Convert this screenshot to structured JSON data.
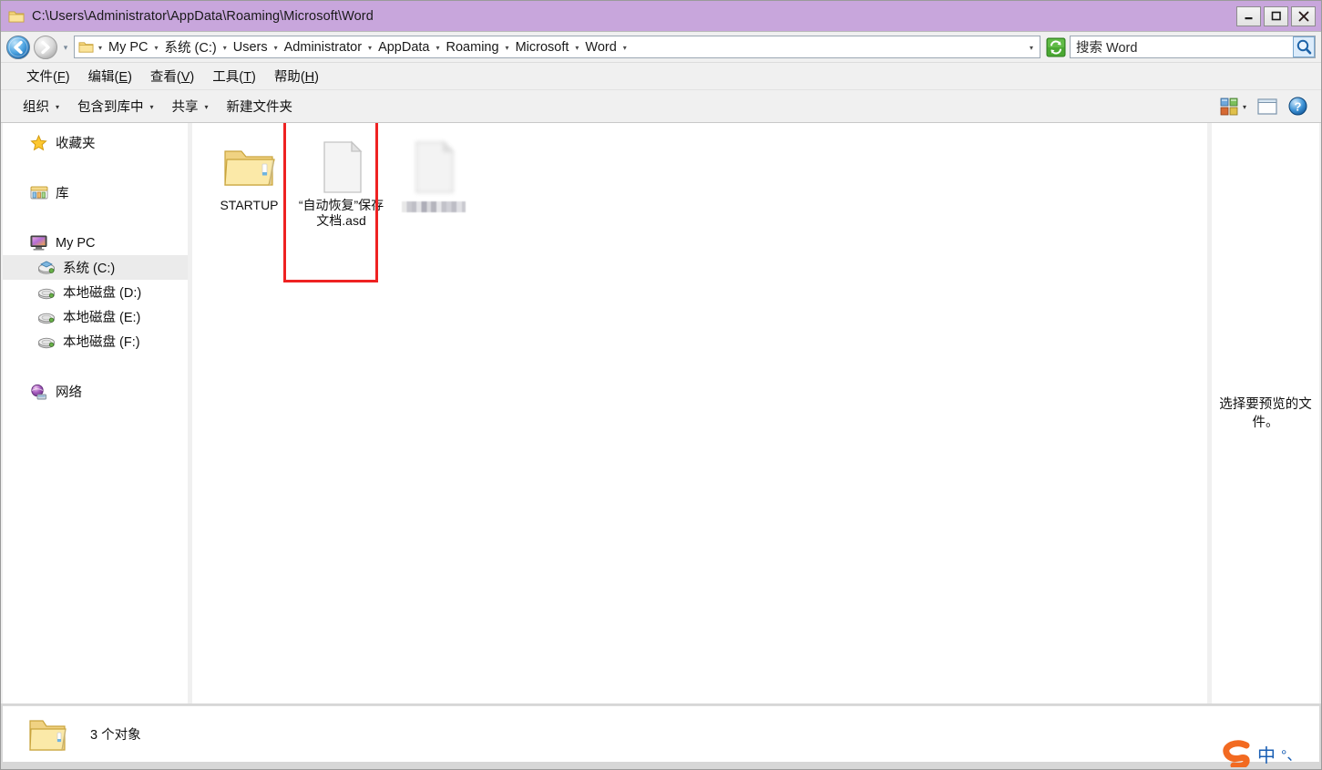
{
  "window": {
    "title": "C:\\Users\\Administrator\\AppData\\Roaming\\Microsoft\\Word",
    "title_icon": "folder-icon",
    "titlebar_color": "#c8a6dc",
    "controls": {
      "minimize_label": "_",
      "maximize_label": "□",
      "close_label": "✕"
    }
  },
  "address": {
    "back_icon": "back-arrow-icon",
    "forward_icon": "forward-arrow-icon",
    "history_caret": "▾",
    "folder_icon": "folder-icon",
    "crumbs": [
      {
        "label": "My PC"
      },
      {
        "label": "系统 (C:)"
      },
      {
        "label": "Users"
      },
      {
        "label": "Administrator"
      },
      {
        "label": "AppData"
      },
      {
        "label": "Roaming"
      },
      {
        "label": "Microsoft"
      },
      {
        "label": "Word"
      }
    ],
    "separator": "▾",
    "dropdown_caret": "▾",
    "refresh_icon": "refresh-icon",
    "search_placeholder": "搜索 Word",
    "search_icon": "magnifier-icon"
  },
  "menu": {
    "items": [
      {
        "text": "文件",
        "accel": "F"
      },
      {
        "text": "编辑",
        "accel": "E"
      },
      {
        "text": "查看",
        "accel": "V"
      },
      {
        "text": "工具",
        "accel": "T"
      },
      {
        "text": "帮助",
        "accel": "H"
      }
    ]
  },
  "toolbar": {
    "organize_label": "组织",
    "include_library_label": "包含到库中",
    "share_label": "共享",
    "new_folder_label": "新建文件夹",
    "caret": "▾",
    "view_icon": "view-options-icon",
    "view_caret": "▾",
    "preview_pane_icon": "preview-pane-icon",
    "help_icon": "help-icon"
  },
  "sidebar": {
    "items": [
      {
        "label": "收藏夹",
        "icon": "star-icon",
        "level": 0,
        "selected": false
      },
      {
        "label": "库",
        "icon": "library-icon",
        "level": 0,
        "selected": false
      },
      {
        "label": "My PC",
        "icon": "monitor-icon",
        "level": 0,
        "selected": false
      },
      {
        "label": "系统 (C:)",
        "icon": "system-drive-icon",
        "level": 1,
        "selected": true
      },
      {
        "label": "本地磁盘 (D:)",
        "icon": "drive-icon",
        "level": 1,
        "selected": false
      },
      {
        "label": "本地磁盘 (E:)",
        "icon": "drive-icon",
        "level": 1,
        "selected": false
      },
      {
        "label": "本地磁盘 (F:)",
        "icon": "drive-icon",
        "level": 1,
        "selected": false
      },
      {
        "label": "网络",
        "icon": "network-icon",
        "level": 0,
        "selected": false
      }
    ]
  },
  "files": [
    {
      "name": "STARTUP",
      "icon": "folder-icon",
      "redacted": false,
      "annotated": false
    },
    {
      "name": "“自动恢复”保存文档.asd",
      "icon": "document-icon",
      "redacted": false,
      "annotated": true
    },
    {
      "name": "",
      "icon": "document-icon",
      "redacted": true,
      "annotated": false
    }
  ],
  "annotation": {
    "color": "#ee2222",
    "target": "“自动恢复”保存文档.asd"
  },
  "preview": {
    "empty_text": "选择要预览的文件。"
  },
  "status": {
    "icon": "folder-icon",
    "text": "3 个对象"
  },
  "ime": {
    "logo": "sogou-logo-icon",
    "mode": "中",
    "punct": "°、"
  }
}
